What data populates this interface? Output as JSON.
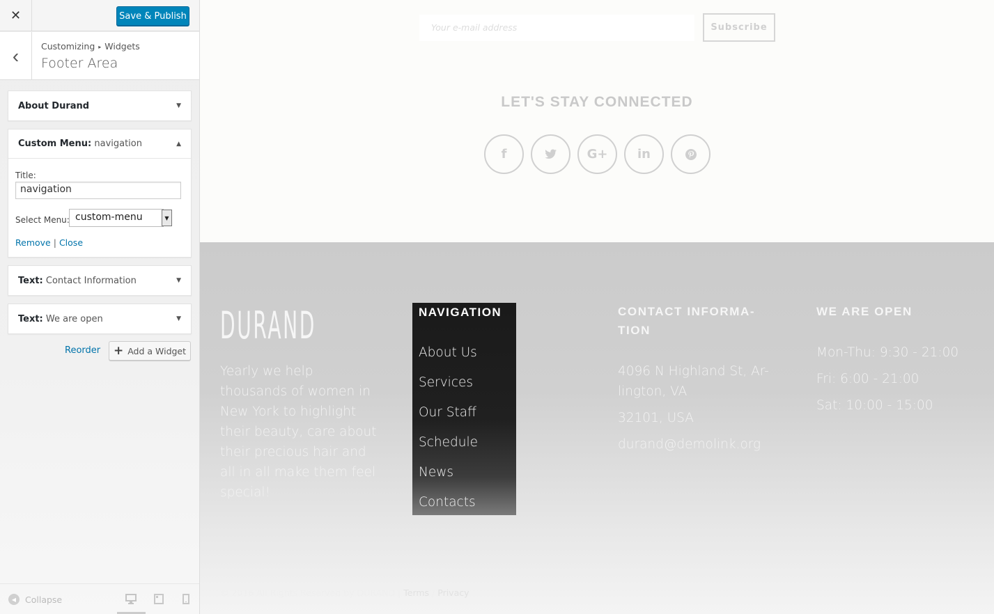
{
  "panel": {
    "close_label": "✕",
    "publish_label": "Save & Publish",
    "back_label": "‹",
    "breadcrumb": [
      "Customizing",
      "Widgets"
    ],
    "breadcrumb_sep": "▸",
    "section_title": "Footer Area",
    "widgets": [
      {
        "type": "About Durand",
        "title": "",
        "expanded": false
      },
      {
        "type": "Custom Menu:",
        "title": "navigation",
        "expanded": true
      },
      {
        "type": "Text:",
        "title": "Contact Information",
        "expanded": false
      },
      {
        "type": "Text:",
        "title": "We are open",
        "expanded": false
      }
    ],
    "custom_menu": {
      "title_label": "Title:",
      "title_value": "navigation",
      "select_label": "Select Menu:",
      "select_value": "custom-menu",
      "remove_label": "Remove",
      "pipe": "|",
      "close_label": "Close"
    },
    "reorder_label": "Reorder",
    "add_widget_label": "Add a Widget",
    "collapse_label": "Collapse",
    "arrow_down": "▼",
    "arrow_up": "▲",
    "select_arrow": "▼"
  },
  "preview": {
    "email_placeholder": "Your e-mail address",
    "subscribe_label": "Subscribe",
    "stay_connected": "LET'S STAY CONNECTED",
    "social": [
      {
        "icon": "facebook-icon",
        "glyph": "f"
      },
      {
        "icon": "twitter-icon",
        "glyph": "t"
      },
      {
        "icon": "google-plus-icon",
        "glyph": "G+"
      },
      {
        "icon": "linkedin-icon",
        "glyph": "in"
      },
      {
        "icon": "pinterest-icon",
        "glyph": "p"
      }
    ],
    "logo": "DURAND",
    "about_text": "Yearly we help thousands of women in New York to highlight their beauty, care about their precious hair and all in all make them feel special!",
    "nav_title": "NAVIGATION",
    "nav_items": [
      "About Us",
      "Services",
      "Our Staff",
      "Schedule",
      "News",
      "Contacts"
    ],
    "contact_title": "CONTACT INFORMA-TION",
    "contact_title_lines": [
      "CONTACT INFORMA-",
      "TION"
    ],
    "contact_address_lines": [
      "4096 N Highland St, Ar-",
      "lington, VA"
    ],
    "contact_zip": "32101, USA",
    "contact_email": "durand@demolink.org",
    "open_title": "WE ARE OPEN",
    "hours": [
      "Mon-Thu: 9:30 - 21:00",
      "Fri: 6:00 - 21:00",
      "Sat: 10:00 - 15:00"
    ],
    "copyright": "© 2016 All Rights Reserved by DURAND |",
    "terms": "Terms",
    "slash": "/",
    "privacy": "Privacy"
  },
  "colors": {
    "publish": "#0085ba",
    "link": "#0073aa",
    "nav_box": "#1a1a1a",
    "footer_bg": "#cbcbcb"
  }
}
